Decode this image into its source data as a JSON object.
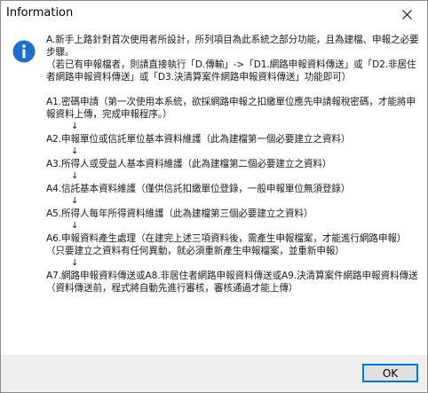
{
  "window": {
    "title": "Information"
  },
  "icons": {
    "info": "info-icon",
    "close": "close-icon"
  },
  "colors": {
    "info_icon_fill": "#1e6fc9",
    "button_border": "#0078d7",
    "footer_bg": "#f0f0f0"
  },
  "message": {
    "intro": "A.新手上路針對首次使用者所設計，所列項目為此系統之部分功能，且為建檔、申報之必要步驟。",
    "intro_note": "（若已有申報檔者，則請直接執行「D.傳輸」->「D1.網路申報資料傳送」或「D2.非居住者網路申報資料傳送」或「D3.決清算案件網路申報資料傳送」功能即可）",
    "step1": "A1.密碼申請（第一次使用本系統，欲採網路申報之扣繳單位應先申請報稅密碼，才能將申報資料上傳，完成申報程序。）",
    "step2": "A2.申報單位或信託單位基本資料維護（此為建檔第一個必要建立之資料）",
    "step3": "A3.所得人或受益人基本資料維護（此為建檔第二個必要建立之資料）",
    "step4": "A4.信託基本資料維護（僅供信託扣繳單位登錄，一般申報單位無須登錄）",
    "step5": "A5.所得人每年所得資料維護（此為建檔第三個必要建立之資料）",
    "step6": "A6.申報資料產生處理（在建完上述三項資料後，需產生申報檔案，才能進行網路申報）",
    "step6_note": "（只要建立之資料有任何異動，就必須重新產生申報檔案，並重新申報）",
    "step7": "A7.網路申報資料傳送或A8.非居住者網路申報資料傳送或A9.決清算案件網路申報資料傳送（資料傳送前，程式將自動先進行審核，審核通過才能上傳）",
    "arrow_glyph": "↓"
  },
  "buttons": {
    "ok_label": "OK"
  }
}
